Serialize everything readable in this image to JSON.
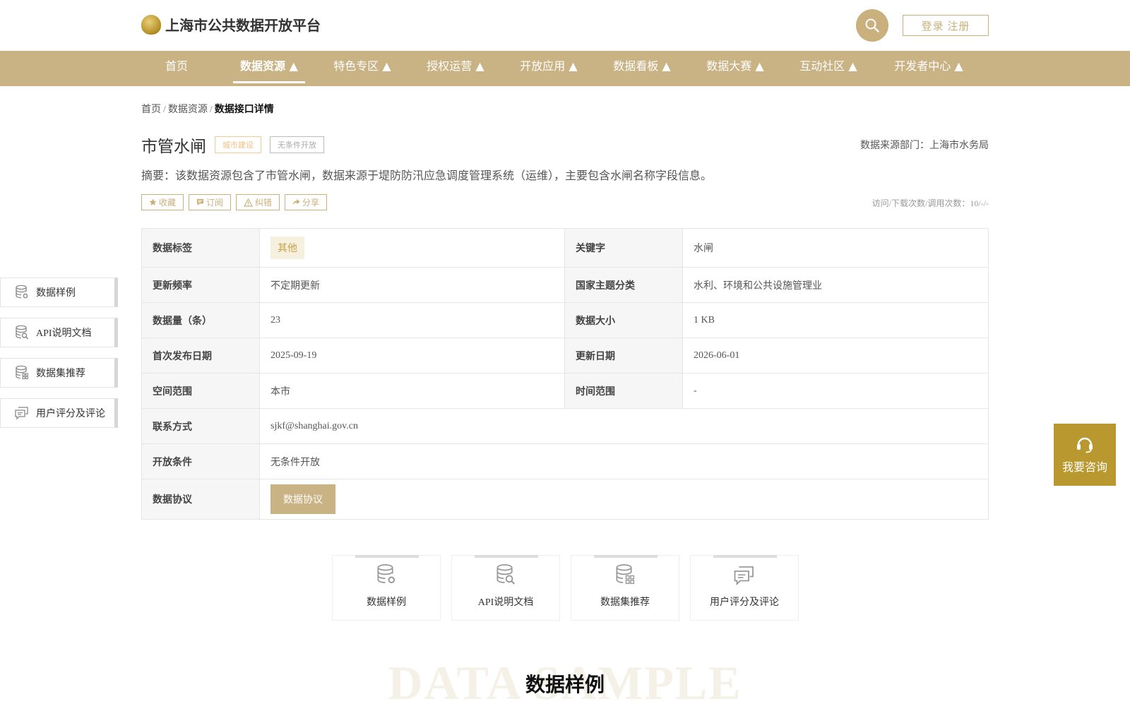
{
  "header": {
    "site_title": "上海市公共数据开放平台",
    "login_label": "登录 注册"
  },
  "nav": {
    "items": [
      {
        "label": "首页"
      },
      {
        "label": "数据资源 ▲"
      },
      {
        "label": "特色专区 ▲"
      },
      {
        "label": "授权运营 ▲"
      },
      {
        "label": "开放应用 ▲"
      },
      {
        "label": "数据看板 ▲"
      },
      {
        "label": "数据大赛 ▲"
      },
      {
        "label": "互动社区 ▲"
      },
      {
        "label": "开发者中心 ▲"
      }
    ],
    "active": "数据资源 ▲"
  },
  "breadcrumb": {
    "home": "首页",
    "sep": "/",
    "parent": "数据资源",
    "current": "数据接口详情"
  },
  "detail": {
    "title": "市管水闸",
    "tag_category": "城市建设",
    "tag_open": "无条件开放",
    "source": "数据来源部门：上海市水务局",
    "abstract": "摘要：该数据资源包含了市管水闸，数据来源于堤防防汛应急调度管理系统（运维），主要包含水闸名称字段信息。",
    "visits": "访问/下载次数/调用次数：10/-/-"
  },
  "actions": {
    "favorite": "收藏",
    "subscribe": "订阅",
    "report": "纠错",
    "share": "分享"
  },
  "info": {
    "tag_label": "数据标签",
    "tag_value": "其他",
    "keyword_label": "关键字",
    "keyword_value": "水闸",
    "freq_label": "更新频率",
    "freq_value": "不定期更新",
    "theme_label": "国家主题分类",
    "theme_value": "水利、环境和公共设施管理业",
    "count_label": "数据量（条）",
    "count_value": "23",
    "size_label": "数据大小",
    "size_value": "1 KB",
    "publish_label": "首次发布日期",
    "publish_value": "2025-09-19",
    "update_label": "更新日期",
    "update_value": "2026-06-01",
    "space_label": "空间范围",
    "space_value": "本市",
    "time_label": "时间范围",
    "time_value": "-",
    "contact_label": "联系方式",
    "contact_value": "sjkf@shanghai.gov.cn",
    "cond_label": "开放条件",
    "cond_value": "无条件开放",
    "protocol_label": "数据协议",
    "protocol_button": "数据协议"
  },
  "sidebar": {
    "items": [
      {
        "label": "数据样例",
        "icon": "database-gear-icon"
      },
      {
        "label": "API说明文档",
        "icon": "database-search-icon"
      },
      {
        "label": "数据集推荐",
        "icon": "database-grid-icon"
      },
      {
        "label": "用户评分及评论",
        "icon": "comments-icon"
      }
    ]
  },
  "consult": {
    "label": "我要咨询",
    "icon": "headset-icon"
  },
  "tabs": {
    "items": [
      {
        "label": "数据样例",
        "icon": "database-gear-icon"
      },
      {
        "label": "API说明文档",
        "icon": "database-search-icon"
      },
      {
        "label": "数据集推荐",
        "icon": "database-grid-icon"
      },
      {
        "label": "用户评分及评论",
        "icon": "comments-icon"
      }
    ]
  },
  "section": {
    "bg_text": "DATA SAMPLE",
    "title": "数据样例"
  },
  "colors": {
    "brand_gold": "#c9b283",
    "consult_gold": "#b9982f"
  }
}
